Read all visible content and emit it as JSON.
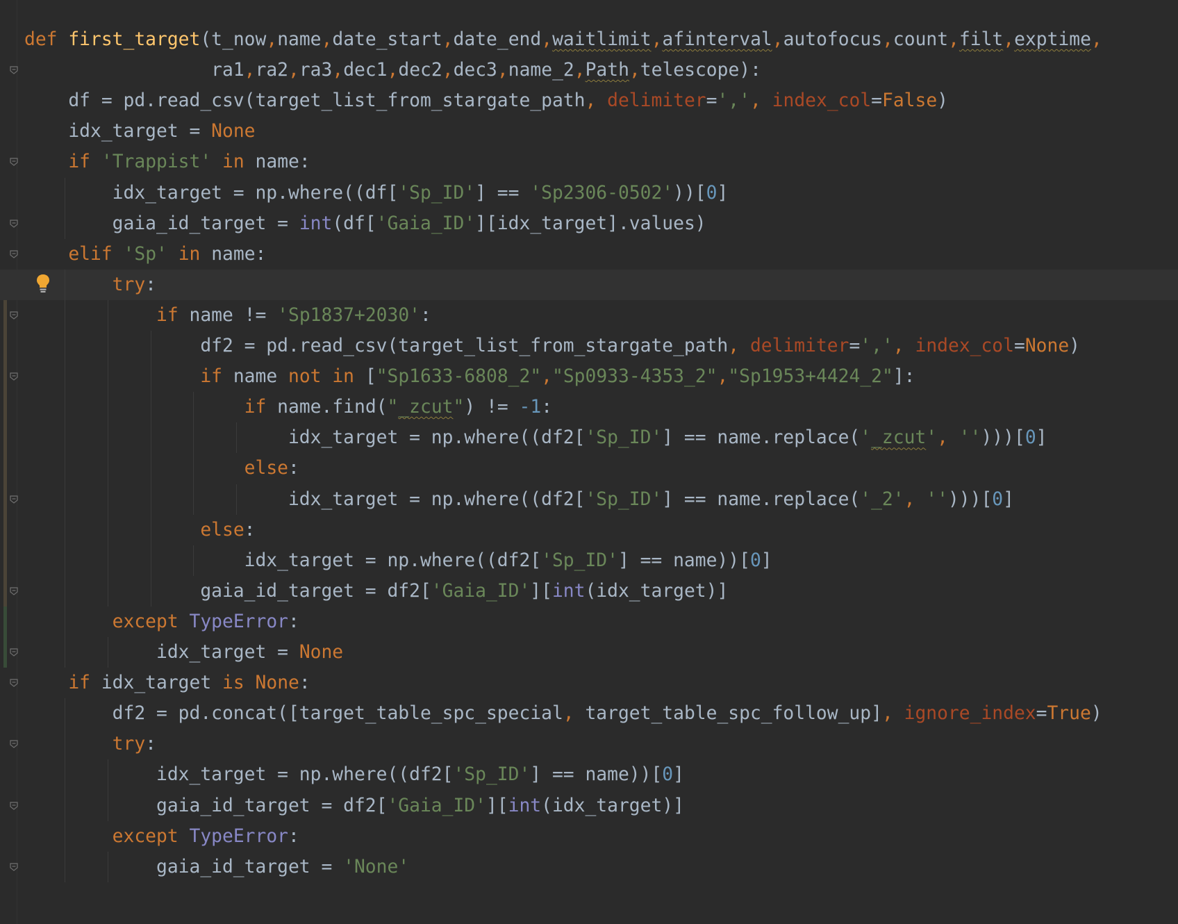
{
  "editor": {
    "file_language": "python",
    "colors": {
      "background": "#2b2b2b",
      "keyword": "#cc7832",
      "function_name": "#ffc66d",
      "string": "#6a8759",
      "number": "#6897bb",
      "builtin": "#8888c6",
      "parameter": "#aa4926",
      "identifier": "#a9b7c6"
    },
    "icons": [
      "lightbulb-icon",
      "fold-marker-icon"
    ],
    "lines": [
      "def first_target(t_now,name,date_start,date_end,waitlimit,afinterval,autofocus,count,filt,exptime,",
      "                 ra1,ra2,ra3,dec1,dec2,dec3,name_2,Path,telescope):",
      "    df = pd.read_csv(target_list_from_stargate_path, delimiter=',', index_col=False)",
      "    idx_target = None",
      "    if 'Trappist' in name:",
      "        idx_target = np.where((df['Sp_ID'] == 'Sp2306-0502'))[0]",
      "        gaia_id_target = int(df['Gaia_ID'][idx_target].values)",
      "    elif 'Sp' in name:",
      "        try:",
      "            if name != 'Sp1837+2030':",
      "                df2 = pd.read_csv(target_list_from_stargate_path, delimiter=',', index_col=None)",
      "                if name not in [\"Sp1633-6808_2\",\"Sp0933-4353_2\",\"Sp1953+4424_2\"]:",
      "                    if name.find(\"_zcut\") != -1:",
      "                        idx_target = np.where((df2['Sp_ID'] == name.replace('_zcut', '')))[0]",
      "                    else:",
      "                        idx_target = np.where((df2['Sp_ID'] == name.replace('_2', '')))[0]",
      "                else:",
      "                    idx_target = np.where((df2['Sp_ID'] == name))[0]",
      "                gaia_id_target = df2['Gaia_ID'][int(idx_target)]",
      "        except TypeError:",
      "            idx_target = None",
      "    if idx_target is None:",
      "        df2 = pd.concat([target_table_spc_special, target_table_spc_follow_up], ignore_index=True)",
      "        try:",
      "            idx_target = np.where((df2['Sp_ID'] == name))[0]",
      "            gaia_id_target = df2['Gaia_ID'][int(idx_target)]",
      "        except TypeError:",
      "            gaia_id_target = 'None'"
    ]
  }
}
